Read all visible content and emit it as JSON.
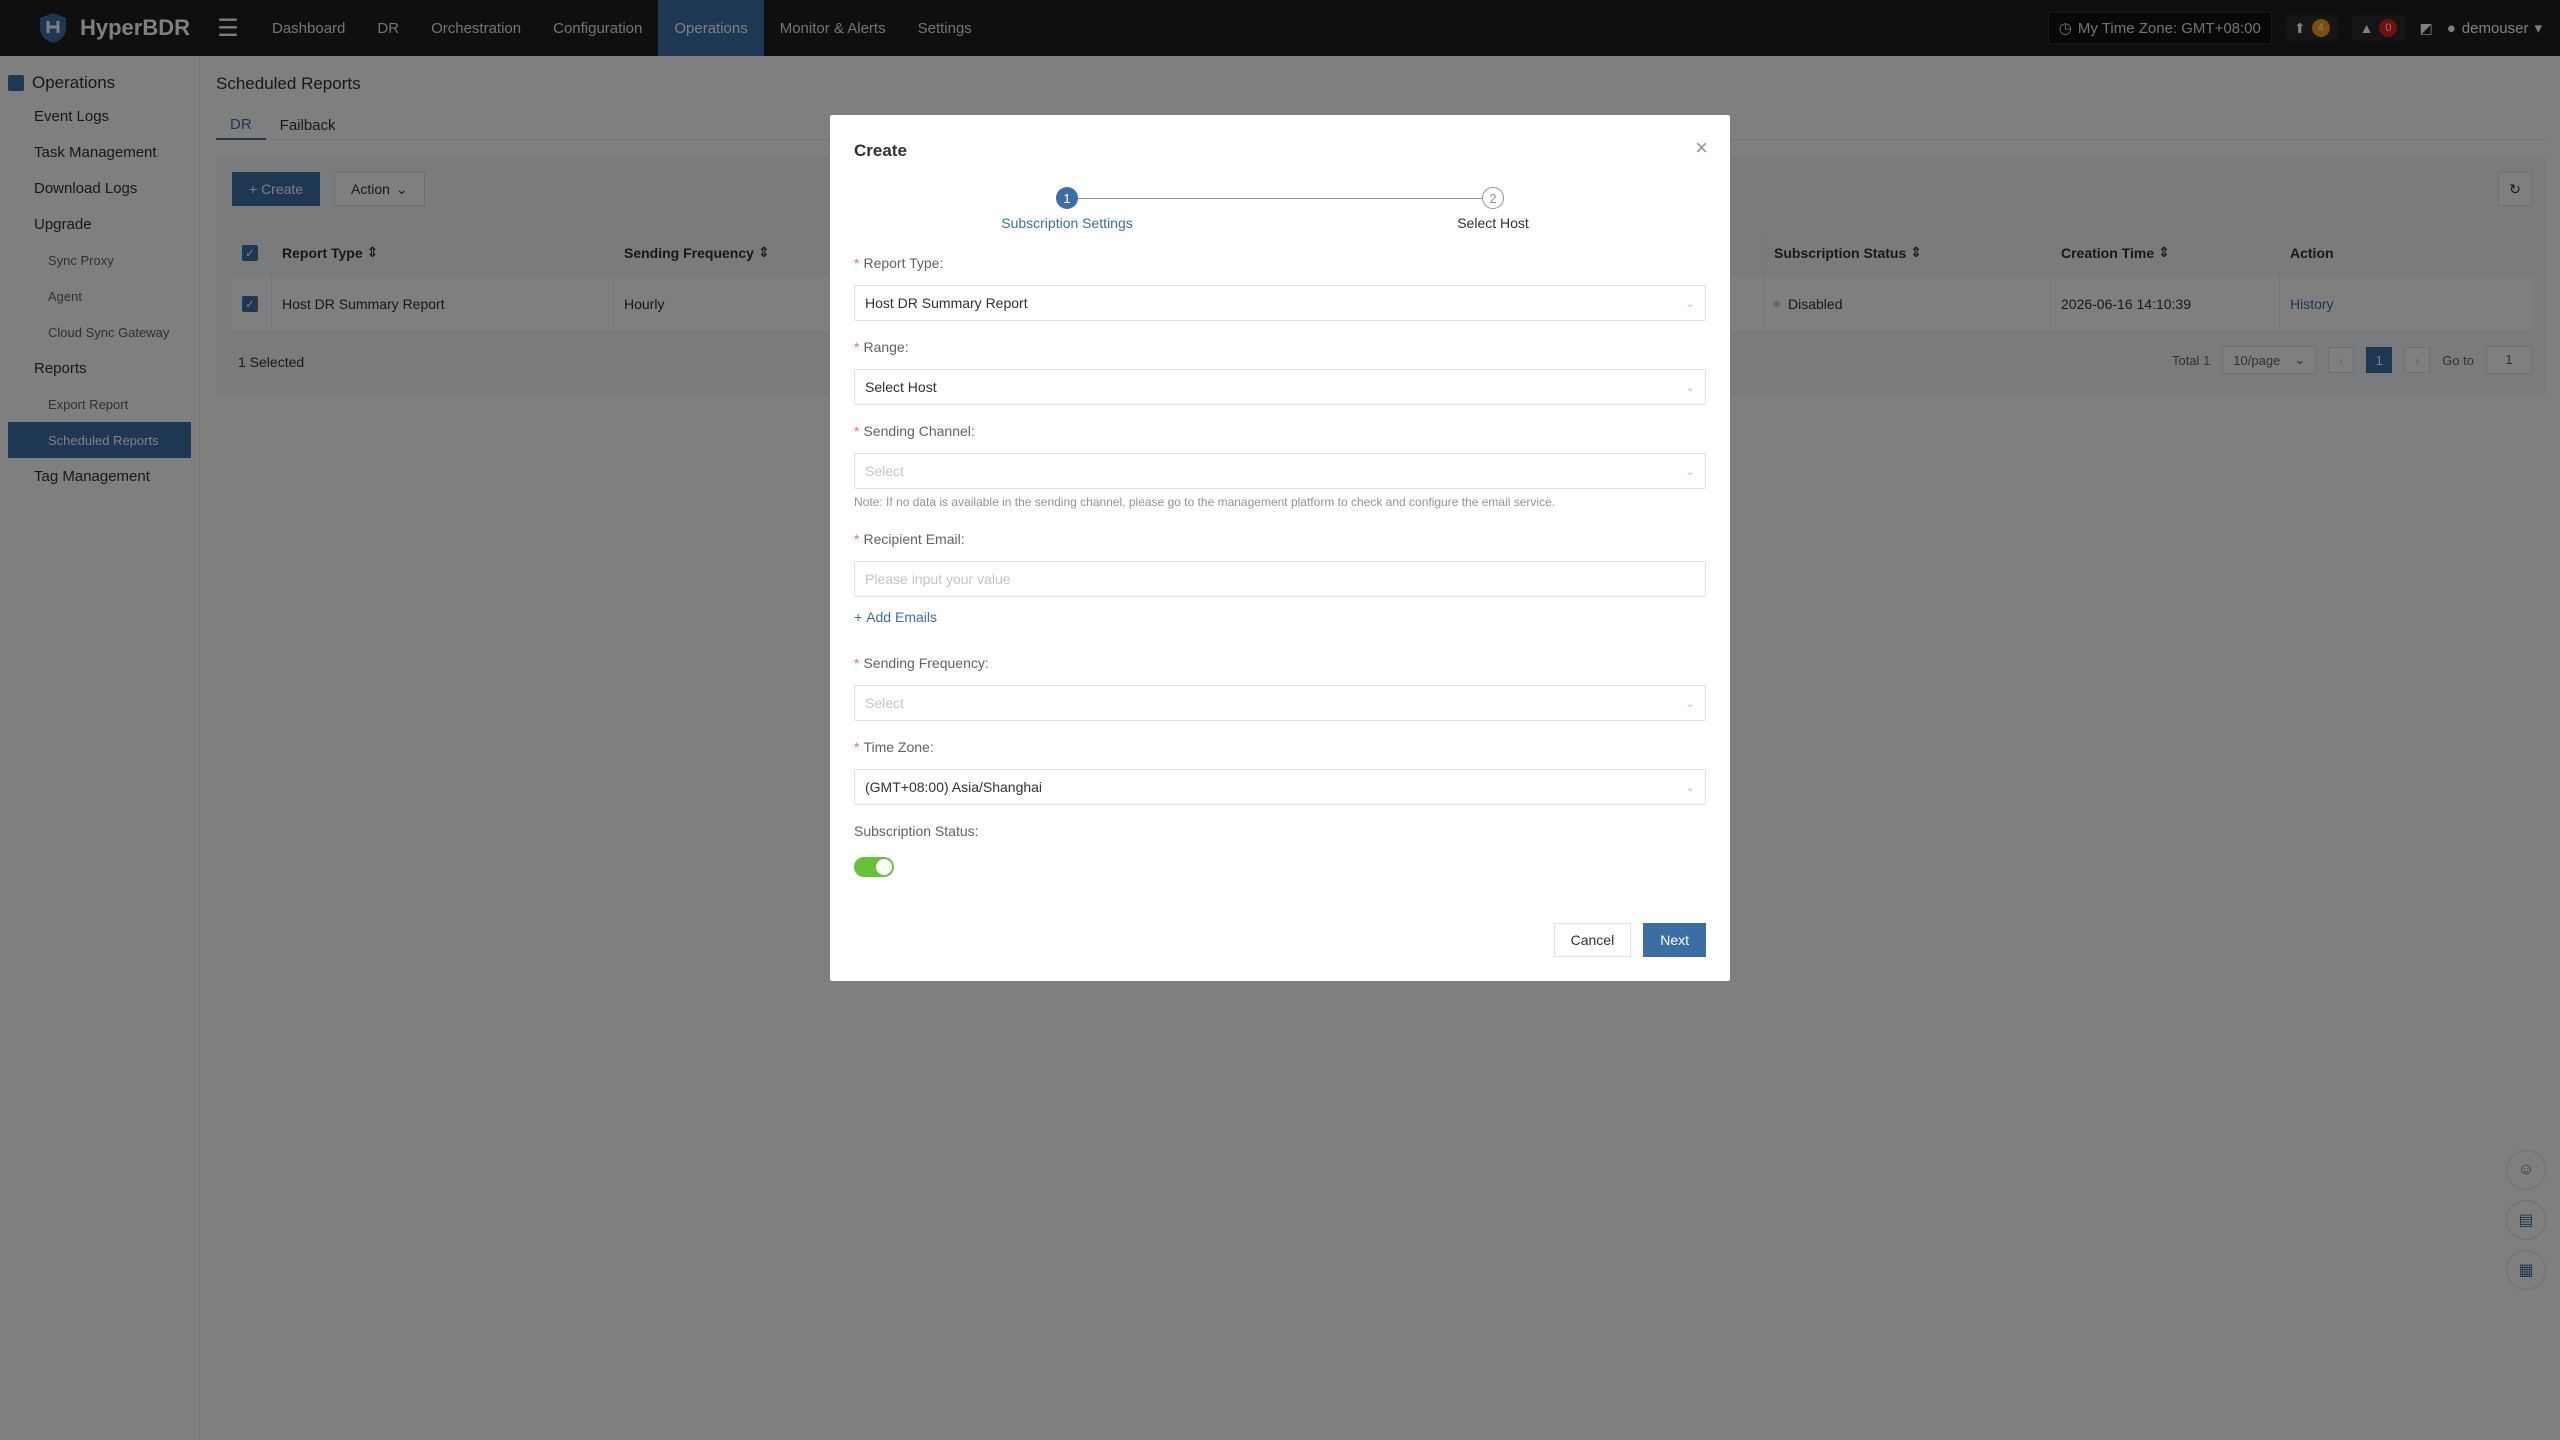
{
  "app": {
    "name": "HyperBDR"
  },
  "nav": {
    "items": [
      {
        "label": "Dashboard",
        "active": false
      },
      {
        "label": "DR",
        "active": false
      },
      {
        "label": "Orchestration",
        "active": false
      },
      {
        "label": "Configuration",
        "active": false
      },
      {
        "label": "Operations",
        "active": true
      },
      {
        "label": "Monitor & Alerts",
        "active": false
      },
      {
        "label": "Settings",
        "active": false
      }
    ],
    "timezone": "My Time Zone: GMT+08:00",
    "upgrade_count": "4",
    "alert_count": "0",
    "user": "demouser"
  },
  "sidebar": {
    "title": "Operations",
    "items": [
      {
        "label": "Event Logs"
      },
      {
        "label": "Task Management"
      },
      {
        "label": "Download Logs"
      },
      {
        "label": "Upgrade"
      },
      {
        "label": "Sync Proxy"
      },
      {
        "label": "Agent"
      },
      {
        "label": "Cloud Sync Gateway"
      },
      {
        "label": "Reports"
      },
      {
        "label": "Export Report"
      },
      {
        "label": "Scheduled Reports"
      },
      {
        "label": "Tag Management"
      }
    ]
  },
  "page": {
    "title": "Scheduled Reports",
    "tabs": [
      "DR",
      "Failback"
    ],
    "create_label": "+ Create",
    "action_label": "Action",
    "table": {
      "headers": [
        "Report Type",
        "Sending Frequency",
        "Subscription Status",
        "Creation Time",
        "Action"
      ],
      "rows": [
        {
          "report_type": "Host DR Summary Report",
          "frequency": "Hourly",
          "status": "Disabled",
          "created": "2026-06-16 14:10:39",
          "action": "History"
        }
      ]
    },
    "selected_text": "1 Selected",
    "pager": {
      "total": "Total 1",
      "per_page": "10/page",
      "current": "1",
      "goto_label": "Go to",
      "goto_value": "1"
    }
  },
  "modal": {
    "title": "Create",
    "steps": [
      {
        "num": "1",
        "label": "Subscription Settings"
      },
      {
        "num": "2",
        "label": "Select Host"
      }
    ],
    "fields": {
      "report_type": {
        "label": "Report Type:",
        "value": "Host DR Summary Report"
      },
      "range": {
        "label": "Range:",
        "value": "Select Host"
      },
      "sending_channel": {
        "label": "Sending Channel:",
        "placeholder": "Select",
        "note": "Note: If no data is available in the sending channel, please go to the management platform to check and configure the email service."
      },
      "recipient_email": {
        "label": "Recipient Email:",
        "placeholder": "Please input your value"
      },
      "add_emails": "Add Emails",
      "sending_frequency": {
        "label": "Sending Frequency:",
        "placeholder": "Select"
      },
      "time_zone": {
        "label": "Time Zone:",
        "value": "(GMT+08:00) Asia/Shanghai"
      },
      "subscription_status": {
        "label": "Subscription Status:",
        "enabled": true
      }
    },
    "cancel_label": "Cancel",
    "next_label": "Next"
  }
}
